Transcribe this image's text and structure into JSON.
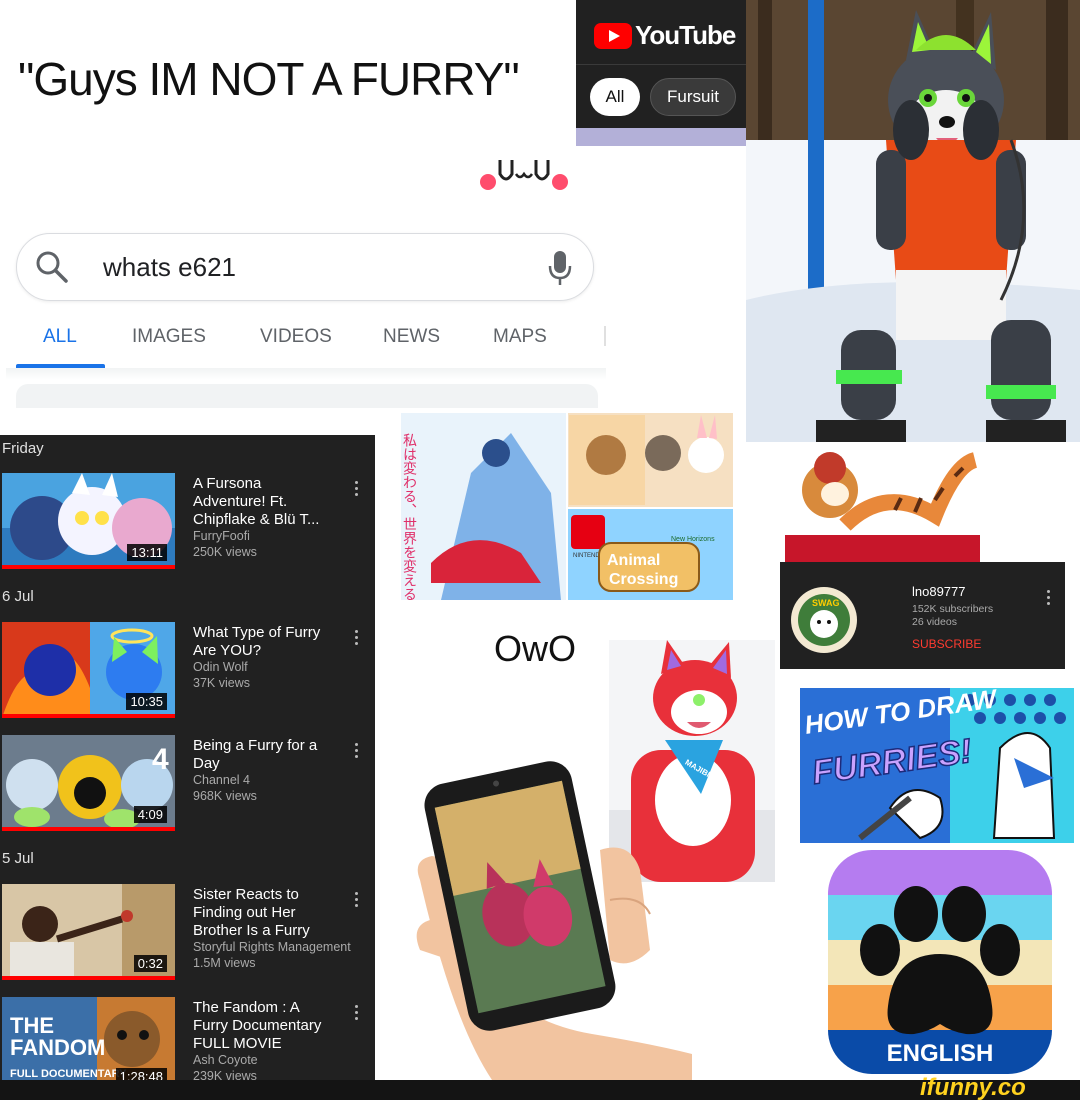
{
  "caption": {
    "text": "\"Guys IM NOT A FURRY\""
  },
  "search": {
    "query": "whats e621",
    "tabs": [
      "ALL",
      "IMAGES",
      "VIDEOS",
      "NEWS",
      "MAPS"
    ],
    "active_tab": "ALL"
  },
  "youtube_header": {
    "logo_text": "YouTube",
    "chips": [
      "All",
      "Fursuit"
    ],
    "selected_chip": "All"
  },
  "history": {
    "groups": [
      {
        "day": "Friday",
        "videos": [
          {
            "title": "A Fursona Adventure! Ft. Chipflake & Blü T...",
            "channel": "FurryFoofi",
            "views": "250K views",
            "duration": "13:11",
            "progress": 1.0
          }
        ]
      },
      {
        "day": "6 Jul",
        "videos": [
          {
            "title": "What Type of Furry Are YOU?",
            "channel": "Odin Wolf",
            "views": "37K views",
            "duration": "10:35",
            "progress": 1.0
          },
          {
            "title": "Being a Furry for a Day",
            "channel": "Channel 4",
            "views": "968K views",
            "duration": "4:09",
            "progress": 1.0
          }
        ]
      },
      {
        "day": "5 Jul",
        "videos": [
          {
            "title": "Sister Reacts to Finding out Her Brother Is a Furry",
            "channel": "Storyful Rights Management",
            "views": "1.5M views",
            "duration": "0:32",
            "progress": 1.0
          },
          {
            "title": "The Fandom : A Furry Documentary FULL MOVIE",
            "channel": "Ash Coyote",
            "views": "239K views",
            "duration": "1:28:48",
            "progress": 0.0
          }
        ]
      }
    ],
    "thumb_texts": {
      "channel4_logo": "4",
      "fandom_title": "THE FANDOM",
      "fandom_sub": "FULL DOCUMENTARY"
    }
  },
  "collage": {
    "japanese_text": "私は変わる、世界を変える。",
    "switch_label": "NINTENDO SWITCH",
    "animal_crossing": "Animal Crossing",
    "new_horizons": "New Horizons"
  },
  "owo": "OwO",
  "channel_card": {
    "name": "lno89777",
    "subscribers": "152K subscribers",
    "videos": "26 videos",
    "subscribe_label": "SUBSCRIBE",
    "avatar_text": "SWAG"
  },
  "fursuit2": {
    "bandana_text": "MAJIBM"
  },
  "how_to_draw": {
    "line1": "HOW TO DRAW",
    "line2": "FURRIES!"
  },
  "app_icon": {
    "label": "ENGLISH"
  },
  "watermark": "ifunny.co",
  "colors": {
    "yt_dark": "#212121",
    "yt_red": "#ff0000",
    "google_blue": "#1a73e8",
    "subscribe_red": "#ff3b30"
  }
}
